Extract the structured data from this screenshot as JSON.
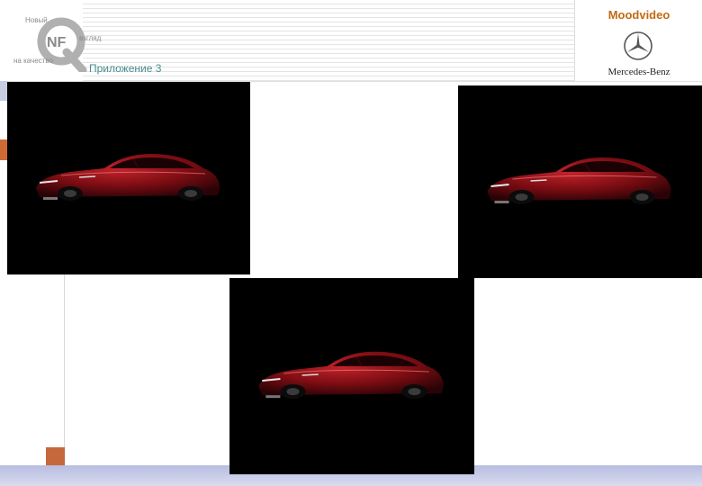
{
  "header": {
    "logo": {
      "word_top": "Новый",
      "word_mid": "взгляд",
      "word_bottom": "на качество",
      "letters": "NF"
    },
    "subtitle": "Приложение 3"
  },
  "brand": {
    "title": "Moodvideo",
    "wordmark": "Mercedes-Benz"
  },
  "colors": {
    "accent_orange": "#c26a12",
    "car_red": "#8e0f16",
    "footer_blue": "#b8bde0"
  },
  "photos": [
    {
      "subject": "red-mercedes-coupe"
    },
    {
      "subject": "red-mercedes-coupe"
    },
    {
      "subject": "red-mercedes-coupe"
    }
  ]
}
